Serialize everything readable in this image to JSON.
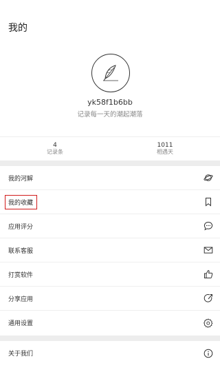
{
  "header": {
    "title": "我的"
  },
  "profile": {
    "username": "yk58f1b6bb",
    "tagline": "记录每一天的潮起潮落"
  },
  "stats": [
    {
      "value": "4",
      "label": "记录条"
    },
    {
      "value": "1011",
      "label": "相遇天"
    }
  ],
  "menu_main": [
    {
      "label": "我的河解",
      "icon": "planet-icon"
    },
    {
      "label": "我的收藏",
      "icon": "bookmark-icon"
    },
    {
      "label": "应用评分",
      "icon": "chat-bubble-icon"
    },
    {
      "label": "联系客服",
      "icon": "mail-icon"
    },
    {
      "label": "打赏软件",
      "icon": "thumbs-up-icon"
    },
    {
      "label": "分享应用",
      "icon": "share-icon"
    },
    {
      "label": "通用设置",
      "icon": "gear-icon"
    }
  ],
  "menu_about": [
    {
      "label": "关于我们",
      "icon": "info-icon"
    }
  ],
  "colors": {
    "highlight": "#d11b1b",
    "band": "#ededed"
  }
}
